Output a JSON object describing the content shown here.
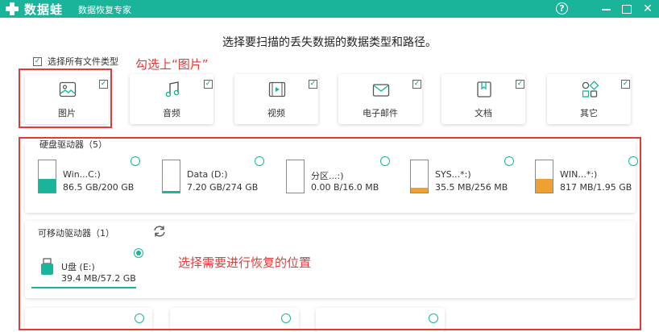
{
  "app": {
    "brand": "数据蛙",
    "title": "数据恢复专家",
    "controls": {
      "help": "?"
    }
  },
  "heading": "选择要扫描的丢失数据的数据类型和路径。",
  "select_all": {
    "label": "选择所有文件类型",
    "checked": true
  },
  "annotations": {
    "check_images": "勾选上“图片”",
    "select_location": "选择需要进行恢复的位置"
  },
  "file_types": [
    {
      "label": "图片",
      "icon": "image-icon",
      "checked": true
    },
    {
      "label": "音频",
      "icon": "audio-icon",
      "checked": true
    },
    {
      "label": "视频",
      "icon": "video-icon",
      "checked": true
    },
    {
      "label": "电子邮件",
      "icon": "email-icon",
      "checked": true
    },
    {
      "label": "文档",
      "icon": "document-icon",
      "checked": true
    },
    {
      "label": "其它",
      "icon": "other-icon",
      "checked": true
    }
  ],
  "hard_drives": {
    "title": "硬盘驱动器（5）",
    "drives": [
      {
        "name": "Win...C:)",
        "size": "86.5 GB/200 GB",
        "used_fraction": 0.43,
        "color": "#19b49a",
        "selected": false
      },
      {
        "name": "Data (D:)",
        "size": "7.20 GB/274 GB",
        "used_fraction": 0.03,
        "color": "#19b49a",
        "selected": false
      },
      {
        "name": "分区...:)",
        "size": "0.00  B/16.0 MB",
        "used_fraction": 0.0,
        "color": "#19b49a",
        "selected": false
      },
      {
        "name": "SYS...*:)",
        "size": "35.5 MB/256 MB",
        "used_fraction": 0.14,
        "color": "#f0a030",
        "selected": false
      },
      {
        "name": "WIN...*:)",
        "size": "817 MB/1.95 GB",
        "used_fraction": 0.42,
        "color": "#f0a030",
        "selected": false
      }
    ]
  },
  "removable_drives": {
    "title": "可移动驱动器（1）",
    "drives": [
      {
        "name": "U盘 (E:)",
        "size": "39.4 MB/57.2 GB",
        "selected": true
      }
    ]
  },
  "colors": {
    "accent": "#19b49a",
    "annotation": "#e53935",
    "warning": "#f0a030"
  }
}
